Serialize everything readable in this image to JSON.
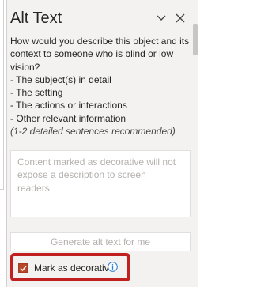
{
  "pane": {
    "title": "Alt Text",
    "prompt_lines": [
      "How would you describe this object and its",
      "context to someone who is blind or low",
      "vision?",
      "- The subject(s) in detail",
      "- The setting",
      "- The actions or interactions",
      "- Other relevant information"
    ],
    "hint": "(1-2 detailed sentences recommended)",
    "textarea_placeholder_lines": [
      "Content marked as decorative will not",
      "expose a description to screen readers."
    ],
    "generate_button_label": "Generate alt text for me",
    "decorative_checkbox_label": "Mark as decorative",
    "decorative_checked": true
  },
  "icons": {
    "collapse": "chevron-down-icon",
    "close": "close-icon",
    "info": "info-icon",
    "check": "check-icon"
  },
  "colors": {
    "pane_background": "#f3f2f1",
    "checkbox_fill": "#b7472a",
    "highlight_border": "#c0201f",
    "info_blue": "#2b7cd3"
  }
}
